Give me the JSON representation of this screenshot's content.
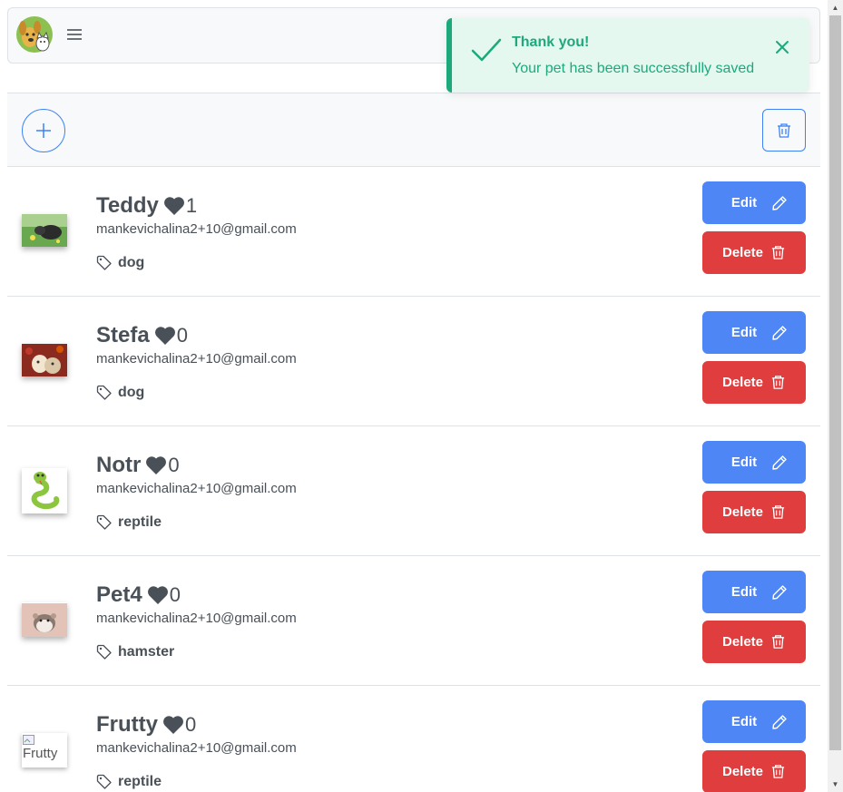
{
  "header": {
    "logo_icon": "dog-cat-logo-icon",
    "menu_icon": "hamburger-menu-icon"
  },
  "toast": {
    "title": "Thank you!",
    "message": "Your pet has been successfully saved",
    "icon": "check-icon",
    "close_icon": "close-icon",
    "color": "#1ea97c",
    "background": "#e4f8f0"
  },
  "toolbar": {
    "add_icon": "plus-icon",
    "delete_all_icon": "trash-icon"
  },
  "pets": [
    {
      "name": "Teddy",
      "likes": "1",
      "email": "mankevichalina2+10@gmail.com",
      "tag": "dog",
      "image": "dog-photo"
    },
    {
      "name": "Stefa",
      "likes": "0",
      "email": "mankevichalina2+10@gmail.com",
      "tag": "dog",
      "image": "dogs-photo"
    },
    {
      "name": "Notr",
      "likes": "0",
      "email": "mankevichalina2+10@gmail.com",
      "tag": "reptile",
      "image": "snake-cartoon"
    },
    {
      "name": "Pet4",
      "likes": "0",
      "email": "mankevichalina2+10@gmail.com",
      "tag": "hamster",
      "image": "hamster-photo"
    },
    {
      "name": "Frutty",
      "likes": "0",
      "email": "mankevichalina2+10@gmail.com",
      "tag": "reptile",
      "image": "broken-image",
      "image_alt": "Frutty"
    }
  ],
  "actions": {
    "edit_label": "Edit",
    "delete_label": "Delete",
    "edit_color": "#4f86f5",
    "delete_color": "#e03e3e"
  }
}
